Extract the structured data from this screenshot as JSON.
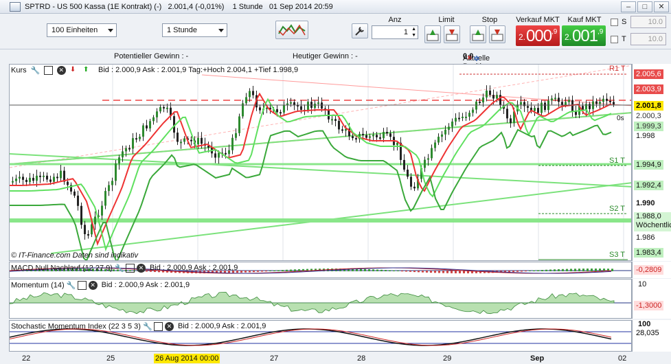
{
  "window": {
    "title": "SPTRD - US 500 Kassa (1E Kontrakt) (-)   2.001,4 (-0,01%)    1 Stunde   01 Sep 2014 20:59"
  },
  "toolbar": {
    "units_select": "100 Einheiten",
    "interval_select": "1 Stunde",
    "anz_label": "Anz",
    "anz_value": "1",
    "limit_label": "Limit",
    "stop_label": "Stop",
    "verkauf_label": "Verkauf MKT",
    "kauf_label": "Kauf MKT",
    "verkauf_prefix": "2.",
    "verkauf_big": "000",
    "verkauf_sup": ",9",
    "kauf_prefix": "2.",
    "kauf_big": "001",
    "kauf_sup": ",9",
    "s_label": "S",
    "t_label": "T",
    "s_value": "10.0",
    "t_value": "10.0"
  },
  "infobar": {
    "potentiell": "Potentieller Gewinn : -",
    "heutiger": "Heutiger Gewinn : -",
    "position_label": "Aktuelle Position : ",
    "position_value": "0",
    "position_sep": "/",
    "position_value2": "0"
  },
  "main_panel": {
    "name": "Kurs",
    "legend": "Bid : 2.000,9 Ask : 2.001,9 Tag:+Hoch 2.004,1 +Tief 1.998,9",
    "watermark": "© IT-Finance.com  Daten sind indikativ",
    "levels": {
      "r1": "R1 T",
      "s1": "S1 T",
      "s2": "S2 T",
      "s3": "S3 T",
      "weekly": "Wöchentlic",
      "os": "0s"
    },
    "y_labels": [
      "2.005,6",
      "2.003,9",
      "2.001,8",
      "2.000,3",
      "1.999,3",
      "1.998",
      "1.994,9",
      "1.992,4",
      "1.990",
      "1.988,0",
      "1.986",
      "1.983,4"
    ]
  },
  "macd_panel": {
    "name": "MACD Null Nachlauf (12 27 9)",
    "legend": "Bid : 2.000,9 Ask : 2.001,9",
    "value": "-0,2809"
  },
  "momentum_panel": {
    "name": "Momentum (14)",
    "legend": "Bid : 2.000,9 Ask : 2.001,9",
    "y_top": "10",
    "value": "-1,3000"
  },
  "stoch_panel": {
    "name": "Stochastic Momentum Index (22 3 5 3)",
    "legend": "Bid : 2.000,9 Ask : 2.001,9",
    "y_top": "100",
    "value": "28,035"
  },
  "xaxis": {
    "labels": [
      "22",
      "25",
      "26 Aug 2014 00:00",
      "27",
      "28",
      "29",
      "Sep",
      "02"
    ]
  },
  "colors": {
    "sell": "#d8302c",
    "buy": "#2f9a3a",
    "up": "#2d8a2f",
    "down": "#c01818",
    "highlight": "#ffe800"
  }
}
